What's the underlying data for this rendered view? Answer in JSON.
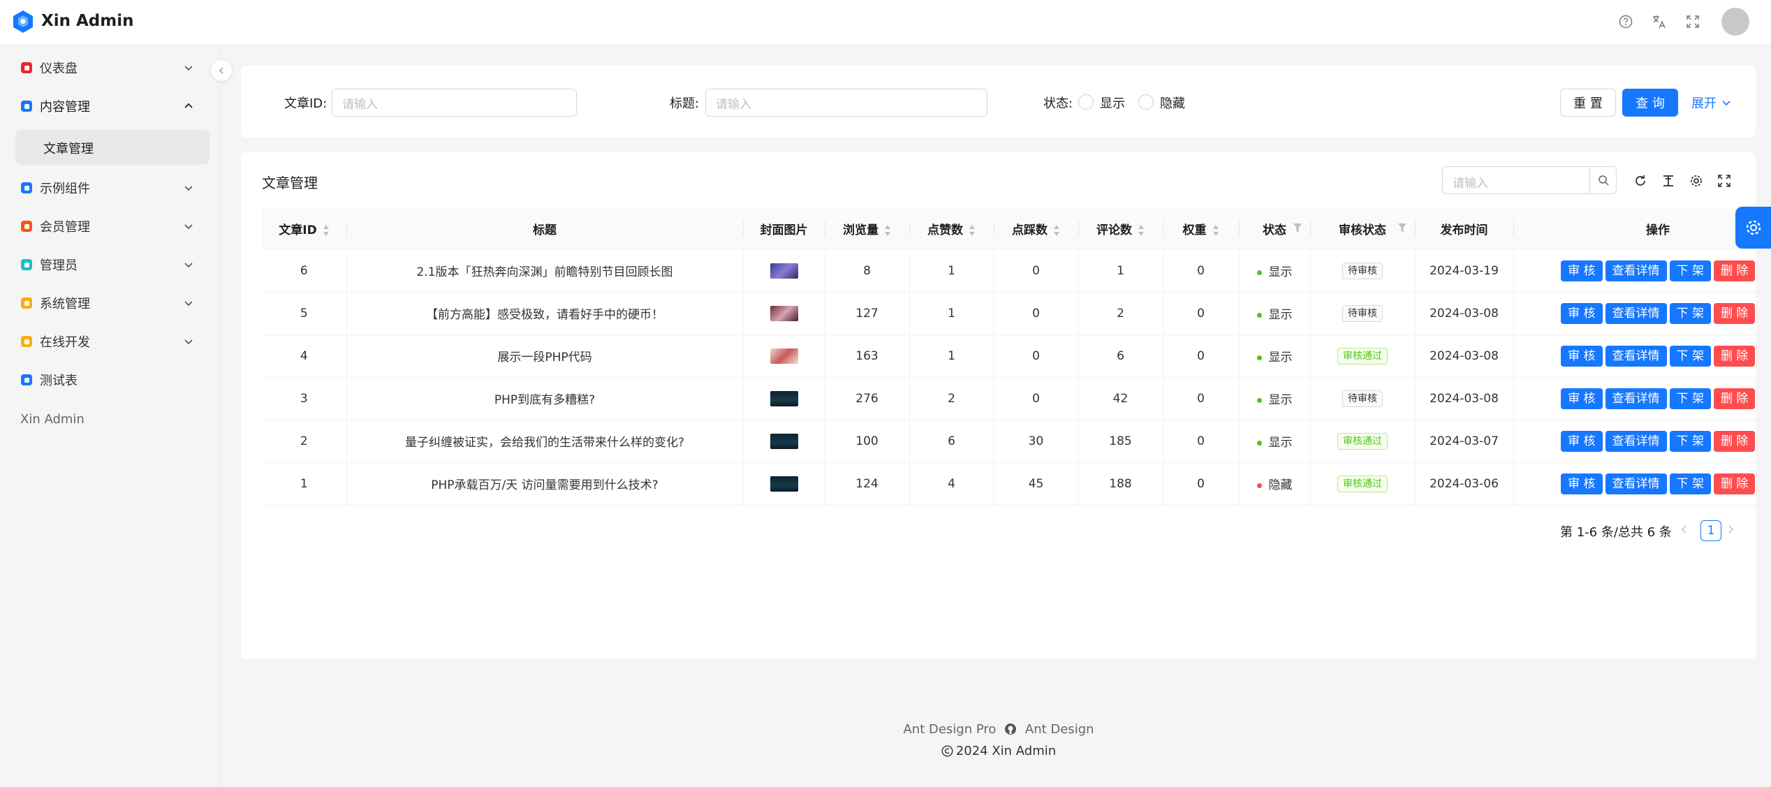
{
  "header": {
    "app_title": "Xin Admin",
    "icons": [
      "help-icon",
      "translate-icon",
      "fullscreen-icon"
    ]
  },
  "sidebar": {
    "items": [
      {
        "label": "仪表盘",
        "icon": "dashboard-icon",
        "color": "#f5222d"
      },
      {
        "label": "内容管理",
        "icon": "content-icon",
        "color": "#1677ff"
      },
      {
        "label": "文章管理"
      },
      {
        "label": "示例组件",
        "icon": "component-icon",
        "color": "#1677ff"
      },
      {
        "label": "会员管理",
        "icon": "member-icon",
        "color": "#fa541c"
      },
      {
        "label": "管理员",
        "icon": "admin-icon",
        "color": "#13c2c2"
      },
      {
        "label": "系统管理",
        "icon": "system-icon",
        "color": "#faad14"
      },
      {
        "label": "在线开发",
        "icon": "dev-icon",
        "color": "#faad14"
      },
      {
        "label": "测试表",
        "icon": "test-icon",
        "color": "#1677ff"
      }
    ],
    "footer": "Xin Admin"
  },
  "search": {
    "id_label": "文章ID",
    "id_placeholder": "请输入",
    "title_label": "标题",
    "title_placeholder": "请输入",
    "status_label": "状态",
    "status_options": [
      "显示",
      "隐藏"
    ],
    "reset_label": "重 置",
    "query_label": "查 询",
    "expand_label": "展开"
  },
  "table_card": {
    "title": "文章管理",
    "search_placeholder": "请输入",
    "columns": [
      "文章ID",
      "标题",
      "封面图片",
      "浏览量",
      "点赞数",
      "点踩数",
      "评论数",
      "权重",
      "状态",
      "审核状态",
      "发布时间",
      "操作"
    ],
    "rows": [
      {
        "id": "6",
        "title": "2.1版本「狂热奔向深渊」前瞻特别节目回顾长图",
        "views": "8",
        "likes": "1",
        "dislikes": "0",
        "comments": "1",
        "weight": "0",
        "status": "显示",
        "audit": "待审核",
        "date": "2024-03-19"
      },
      {
        "id": "5",
        "title": "【前方高能】感受极致，请看好手中的硬币！",
        "views": "127",
        "likes": "1",
        "dislikes": "0",
        "comments": "2",
        "weight": "0",
        "status": "显示",
        "audit": "待审核",
        "date": "2024-03-08"
      },
      {
        "id": "4",
        "title": "展示一段PHP代码",
        "views": "163",
        "likes": "1",
        "dislikes": "0",
        "comments": "6",
        "weight": "0",
        "status": "显示",
        "audit": "审核通过",
        "date": "2024-03-08"
      },
      {
        "id": "3",
        "title": "PHP到底有多糟糕?",
        "views": "276",
        "likes": "2",
        "dislikes": "0",
        "comments": "42",
        "weight": "0",
        "status": "显示",
        "audit": "待审核",
        "date": "2024-03-08"
      },
      {
        "id": "2",
        "title": "量子纠缠被证实，会给我们的生活带来什么样的变化?",
        "views": "100",
        "likes": "6",
        "dislikes": "30",
        "comments": "185",
        "weight": "0",
        "status": "显示",
        "audit": "审核通过",
        "date": "2024-03-07"
      },
      {
        "id": "1",
        "title": "PHP承载百万/天 访问量需要用到什么技术?",
        "views": "124",
        "likes": "4",
        "dislikes": "45",
        "comments": "188",
        "weight": "0",
        "status": "隐藏",
        "audit": "审核通过",
        "date": "2024-03-06"
      }
    ],
    "actions": [
      "审 核",
      "查看详情",
      "下 架",
      "删 除"
    ],
    "pagination": {
      "total_text": "第 1-6 条/总共 6 条",
      "current": "1"
    }
  },
  "footer": {
    "link1": "Ant Design Pro",
    "link2": "Ant Design",
    "copyright": "2024 Xin Admin"
  },
  "colors": {
    "primary": "#1677ff",
    "danger": "#ff4d4f",
    "success": "#52c41a"
  }
}
